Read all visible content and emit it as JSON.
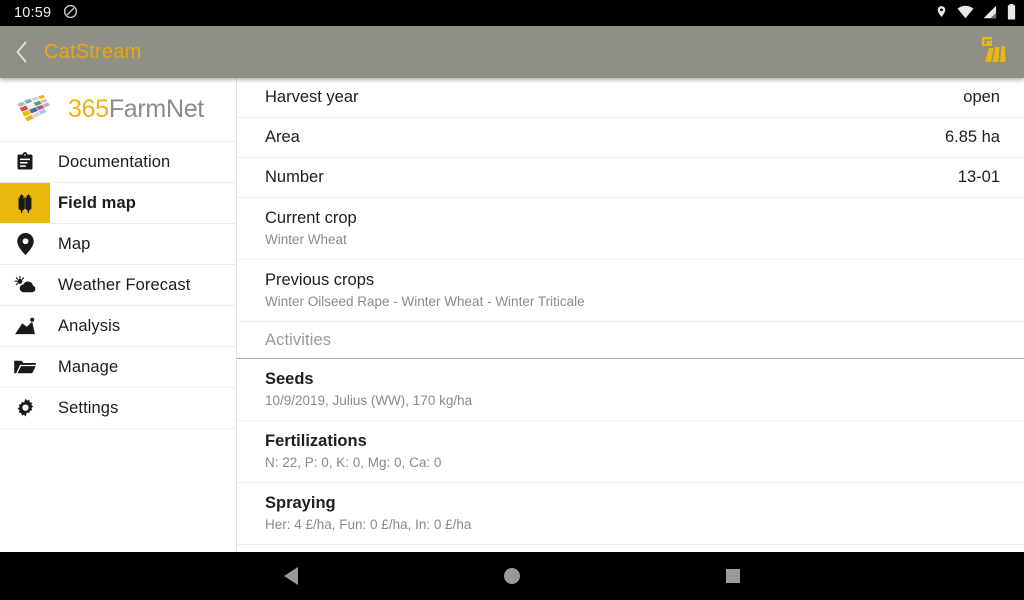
{
  "status_bar": {
    "clock": "10:59",
    "left_icons": [
      "dnd-icon"
    ],
    "right_icons": [
      "location-icon",
      "wifi-icon",
      "signal-icon",
      "battery-icon"
    ]
  },
  "app_bar": {
    "back_icon": "chevron-left-icon",
    "title": "CatStream",
    "action_icon": "field-map-icon",
    "background_color": "#8f8f85",
    "title_color": "#e8a90c"
  },
  "sidebar": {
    "brand": {
      "logo_icon": "365farmnet-logo-icon",
      "name_part1": "365",
      "name_part2": "FarmNet",
      "color1": "#edb211",
      "color2": "#8b8b8b"
    },
    "active_color": "#e8b80e",
    "items": [
      {
        "label": "Documentation",
        "icon": "clipboard-icon",
        "active": false
      },
      {
        "label": "Field map",
        "icon": "wheat-icon",
        "active": true
      },
      {
        "label": "Map",
        "icon": "map-pin-icon",
        "active": false
      },
      {
        "label": "Weather Forecast",
        "icon": "weather-icon",
        "active": false
      },
      {
        "label": "Analysis",
        "icon": "chart-icon",
        "active": false
      },
      {
        "label": "Manage",
        "icon": "folder-icon",
        "active": false
      },
      {
        "label": "Settings",
        "icon": "gear-icon",
        "active": false
      }
    ]
  },
  "content": {
    "detail_rows": [
      {
        "label": "Harvest year",
        "value": "open"
      },
      {
        "label": "Area",
        "value": "6.85 ha"
      },
      {
        "label": "Number",
        "value": "13-01"
      }
    ],
    "crop_rows": [
      {
        "title": "Current crop",
        "subtitle": "Winter Wheat"
      },
      {
        "title": "Previous crops",
        "subtitle": "Winter Oilseed Rape - Winter Wheat - Winter Triticale"
      }
    ],
    "activities_header": "Activities",
    "activities": [
      {
        "title": "Seeds",
        "subtitle": "10/9/2019, Julius (WW), 170 kg/ha"
      },
      {
        "title": "Fertilizations",
        "subtitle": "N: 22, P: 0, K: 0, Mg: 0, Ca: 0"
      },
      {
        "title": "Spraying",
        "subtitle": "Her: 4 £/ha, Fun: 0 £/ha, In: 0 £/ha"
      }
    ]
  },
  "nav_bar": {
    "buttons": [
      {
        "name": "back",
        "icon": "triangle-back-icon"
      },
      {
        "name": "home",
        "icon": "circle-home-icon"
      },
      {
        "name": "recents",
        "icon": "square-recents-icon"
      }
    ]
  }
}
